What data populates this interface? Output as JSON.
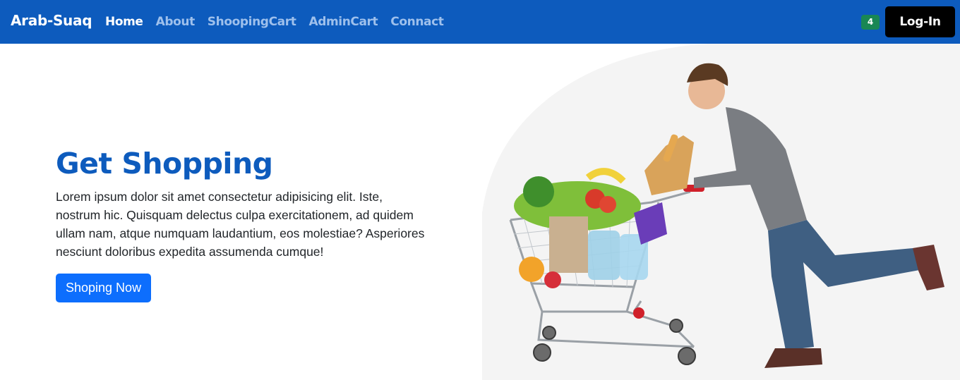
{
  "navbar": {
    "brand": "Arab-Suaq",
    "links": [
      {
        "label": "Home",
        "active": true
      },
      {
        "label": "About",
        "active": false
      },
      {
        "label": "ShoopingCart",
        "active": false
      },
      {
        "label": "AdminCart",
        "active": false
      },
      {
        "label": "Connact",
        "active": false
      }
    ],
    "cart_count": "4",
    "login_label": "Log-In"
  },
  "hero": {
    "title": "Get Shopping",
    "paragraph": "Lorem ipsum dolor sit amet consectetur adipisicing elit. Iste, nostrum hic. Quisquam delectus culpa exercitationem, ad quidem ullam nam, atque numquam laudantium, eos molestiae? Asperiores nesciunt doloribus expedita assumenda cumque!",
    "button_label": "Shoping Now"
  },
  "colors": {
    "navbar": "#0d5bbd",
    "title": "#0d5bbd",
    "primary_button": "#0d6efd",
    "badge": "#198754",
    "login_button": "#000000"
  }
}
